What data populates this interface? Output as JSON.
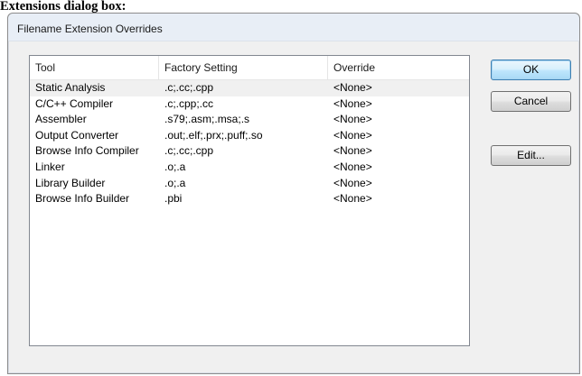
{
  "page_caption": "Extensions dialog box:",
  "dialog": {
    "title": "Filename Extension Overrides"
  },
  "list": {
    "columns": [
      "Tool",
      "Factory Setting",
      "Override"
    ],
    "rows": [
      [
        "Static Analysis",
        ".c;.cc;.cpp",
        "<None>"
      ],
      [
        "C/C++ Compiler",
        ".c;.cpp;.cc",
        "<None>"
      ],
      [
        "Assembler",
        ".s79;.asm;.msa;.s",
        "<None>"
      ],
      [
        "Output Converter",
        ".out;.elf;.prx;.puff;.so",
        "<None>"
      ],
      [
        "Browse Info Compiler",
        ".c;.cc;.cpp",
        "<None>"
      ],
      [
        "Linker",
        ".o;.a",
        "<None>"
      ],
      [
        "Library Builder",
        ".o;.a",
        "<None>"
      ],
      [
        "Browse Info Builder",
        ".pbi",
        "<None>"
      ]
    ]
  },
  "buttons": {
    "ok": "OK",
    "cancel": "Cancel",
    "edit": "Edit..."
  }
}
